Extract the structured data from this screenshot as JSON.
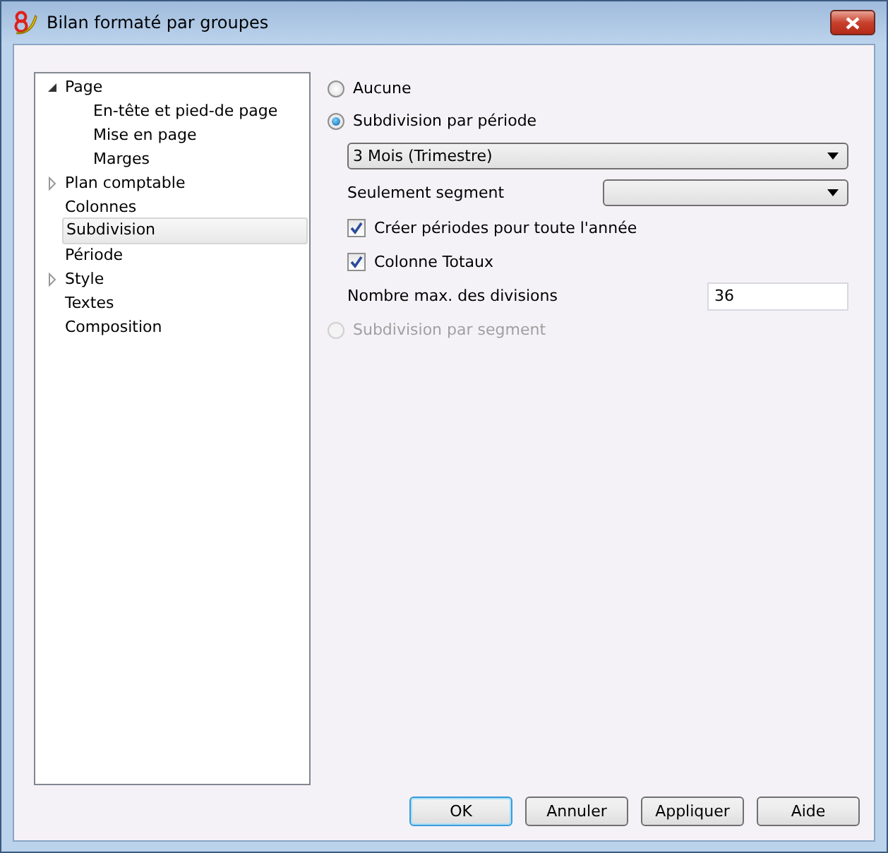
{
  "window": {
    "title": "Bilan formaté par groupes"
  },
  "tree": [
    {
      "label": "Page",
      "expanded": true,
      "selected": false,
      "children": [
        {
          "label": "En-tête et pied-de page",
          "selected": false
        },
        {
          "label": "Mise en page",
          "selected": false
        },
        {
          "label": "Marges",
          "selected": false
        }
      ]
    },
    {
      "label": "Plan comptable",
      "expanded": false,
      "selected": false
    },
    {
      "label": "Colonnes",
      "selected": false
    },
    {
      "label": "Subdivision",
      "selected": true
    },
    {
      "label": "Période",
      "selected": false
    },
    {
      "label": "Style",
      "expanded": false,
      "selected": false
    },
    {
      "label": "Textes",
      "selected": false
    },
    {
      "label": "Composition",
      "selected": false
    }
  ],
  "options": [
    {
      "kind": "radio",
      "label": "Aucune",
      "selected": false,
      "disabled": false
    },
    {
      "kind": "radio",
      "label": "Subdivision par période",
      "selected": true,
      "disabled": false
    },
    {
      "kind": "dropdown",
      "value": "3 Mois (Trimestre)"
    },
    {
      "kind": "labeled_dropdown",
      "label": "Seulement segment"
    },
    {
      "kind": "checkbox",
      "label": "Créer périodes pour toute l'année",
      "checked": true
    },
    {
      "kind": "checkbox",
      "label": "Colonne Totaux",
      "checked": true
    },
    {
      "kind": "labeled_input",
      "label": "Nombre max. des divisions",
      "value": "36"
    },
    {
      "kind": "radio",
      "label": "Subdivision par segment",
      "selected": false,
      "disabled": true
    }
  ],
  "buttons": [
    {
      "label": "OK",
      "default": true
    },
    {
      "label": "Annuler",
      "default": false
    },
    {
      "label": "Appliquer",
      "default": false
    },
    {
      "label": "Aide",
      "default": false
    }
  ]
}
